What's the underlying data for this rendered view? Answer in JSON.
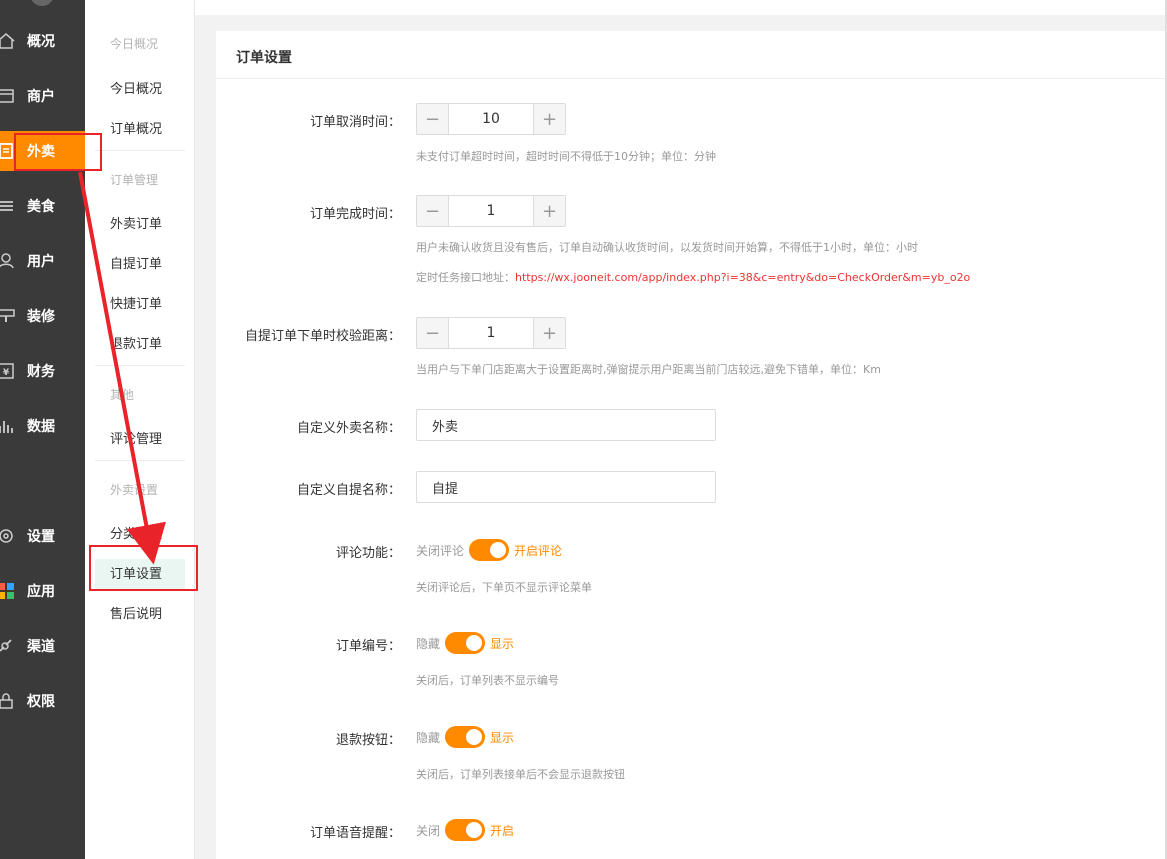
{
  "rail": {
    "items": [
      {
        "label": "概况",
        "icon": "home-icon"
      },
      {
        "label": "商户",
        "icon": "store-icon"
      },
      {
        "label": "外卖",
        "icon": "document-icon",
        "active": true
      },
      {
        "label": "美食",
        "icon": "menu-icon"
      },
      {
        "label": "用户",
        "icon": "user-icon"
      },
      {
        "label": "装修",
        "icon": "decor-icon"
      },
      {
        "label": "财务",
        "icon": "finance-icon"
      },
      {
        "label": "数据",
        "icon": "chart-icon"
      },
      {
        "label": "设置",
        "icon": "gear-icon"
      },
      {
        "label": "应用",
        "icon": "apps-icon"
      },
      {
        "label": "渠道",
        "icon": "channel-icon"
      },
      {
        "label": "权限",
        "icon": "lock-icon"
      }
    ]
  },
  "subnav": {
    "head_today": "今日概况",
    "today_overview": "今日概况",
    "order_overview": "订单概况",
    "head_orders": "订单管理",
    "takeout_orders": "外卖订单",
    "pickup_orders": "自提订单",
    "quick_orders": "快捷订单",
    "refund_orders": "退款订单",
    "head_other": "其他",
    "review_mgmt": "评论管理",
    "head_takeout_settings": "外卖设置",
    "category_mgmt": "分类管理",
    "order_settings": "订单设置",
    "after_sales": "售后说明"
  },
  "panel": {
    "title": "订单设置",
    "cancel_time": {
      "label": "订单取消时间：",
      "value": "10",
      "hint": "未支付订单超时时间，超时时间不得低于10分钟；单位：分钟"
    },
    "complete_time": {
      "label": "订单完成时间：",
      "value": "1",
      "hint": "用户未确认收货且没有售后，订单自动确认收货时间，以发货时间开始算，不得低于1小时，单位：小时",
      "cron_label": "定时任务接口地址：",
      "cron_url": "https://wx.jooneit.com/app/index.php?i=38&c=entry&do=CheckOrder&m=yb_o2o"
    },
    "pickup_distance": {
      "label": "自提订单下单时校验距离：",
      "value": "1",
      "hint": "当用户与下单门店距离大于设置距离时,弹窗提示用户距离当前门店较远,避免下错单，单位：Km"
    },
    "takeout_name": {
      "label": "自定义外卖名称：",
      "value": "外卖"
    },
    "pickup_name": {
      "label": "自定义自提名称：",
      "value": "自提"
    },
    "review": {
      "label": "评论功能：",
      "off": "关闭评论",
      "on": "开启评论",
      "hint": "关闭评论后，下单页不显示评论菜单"
    },
    "order_no": {
      "label": "订单编号：",
      "off": "隐藏",
      "on": "显示",
      "hint": "关闭后，订单列表不显示编号"
    },
    "refund_btn": {
      "label": "退款按钮：",
      "off": "隐藏",
      "on": "显示",
      "hint": "关闭后，订单列表接单后不会显示退款按钮"
    },
    "voice": {
      "label": "订单语音提醒：",
      "off": "关闭",
      "on": "开启"
    }
  },
  "colors": {
    "accent": "#ff8a00",
    "rail_bg": "#3a3a3a",
    "annotation": "#e8242a"
  }
}
